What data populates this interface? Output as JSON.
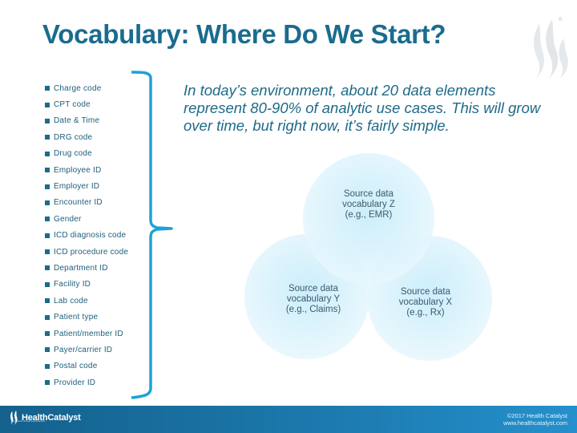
{
  "slide": {
    "title": "Vocabulary: Where Do We Start?",
    "quote": "In today’s environment, about 20 data elements represent 80-90% of analytic use cases.  This will grow over time, but right now, it’s fairly simple.",
    "registered_mark": "®"
  },
  "data_elements": [
    "Charge code",
    "CPT code",
    "Date & Time",
    "DRG code",
    "Drug code",
    "Employee ID",
    "Employer ID",
    "Encounter ID",
    "Gender",
    "ICD diagnosis code",
    "ICD procedure code",
    "Department  ID",
    "Facility ID",
    "Lab code",
    "Patient type",
    "Patient/member ID",
    "Payer/carrier ID",
    "Postal code",
    "Provider ID"
  ],
  "venn": {
    "circles": [
      {
        "id": "z",
        "line1": "Source data",
        "line2": "vocabulary Z",
        "line3": "(e.g., EMR)"
      },
      {
        "id": "y",
        "line1": "Source data",
        "line2": "vocabulary Y",
        "line3": "(e.g., Claims)"
      },
      {
        "id": "x",
        "line1": "Source data",
        "line2": "vocabulary X",
        "line3": "(e.g., Rx)"
      }
    ]
  },
  "footer": {
    "logo_name": "HealthCatalyst",
    "logo_tagline": "Systemic clinical improvement",
    "copyright": "©2017 Health Catalyst",
    "website": "www.healthcatalyst.com"
  },
  "colors": {
    "title": "#1a6c8e",
    "bracket": "#1ea2d6",
    "footer_start": "#14618c",
    "footer_end": "#2590cc",
    "circle_fill": "#cdeefb"
  }
}
